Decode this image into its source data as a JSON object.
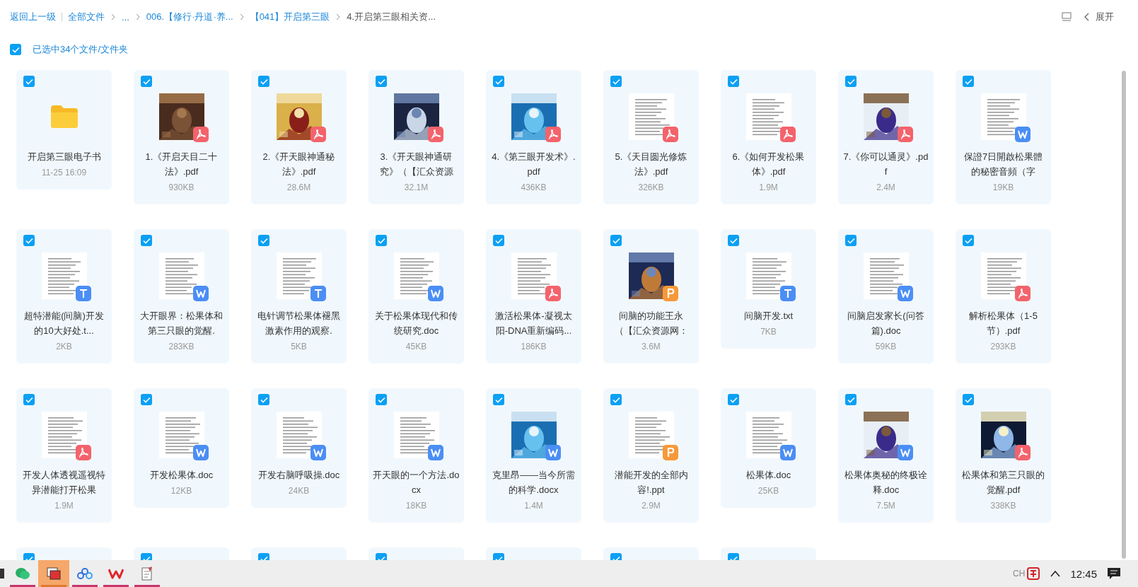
{
  "breadcrumb": {
    "back": "返回上一级",
    "items": [
      "全部文件",
      "...",
      "006.【修行·丹道·养...",
      "【041】开启第三眼"
    ],
    "current": "4.开启第三眼相关资..."
  },
  "expand_button": "展开",
  "selection": {
    "selected": true,
    "label": "已选中34个文件/文件夹"
  },
  "files": [
    {
      "kind": "folder",
      "name": "开启第三眼电子书",
      "meta": "11-25 16:09",
      "selected": true
    },
    {
      "kind": "pdf",
      "cover": true,
      "name": "1.《开启天目二十法》.pdf",
      "meta": "930KB",
      "selected": true
    },
    {
      "kind": "pdf",
      "cover": true,
      "name": "2.《开天眼神通秘法》.pdf",
      "meta": "28.6M",
      "selected": true
    },
    {
      "kind": "pdf",
      "cover": true,
      "name": "3.《开天眼神通研究》（【汇众资源",
      "meta": "32.1M",
      "selected": true
    },
    {
      "kind": "pdf",
      "cover": true,
      "name": "4.《第三眼开发术》.pdf",
      "meta": "436KB",
      "selected": true
    },
    {
      "kind": "pdf",
      "cover": false,
      "name": "5.《天目圆光修炼法》.pdf",
      "meta": "326KB",
      "selected": true
    },
    {
      "kind": "pdf",
      "cover": false,
      "name": "6.《如何开发松果体》.pdf",
      "meta": "1.9M",
      "selected": true
    },
    {
      "kind": "pdf",
      "cover": true,
      "name": "7.《你可以通灵》.pdf",
      "meta": "2.4M",
      "selected": true
    },
    {
      "kind": "doc",
      "cover": false,
      "name": "保證7日開啟松果體的秘密音頻（字",
      "meta": "19KB",
      "selected": true
    },
    {
      "kind": "txt",
      "cover": false,
      "name": "超特潜能(间脑)开发的10大好处.t...",
      "meta": "2KB",
      "selected": true
    },
    {
      "kind": "doc",
      "cover": false,
      "name": "大开眼界：松果体和第三只眼的觉醒.",
      "meta": "283KB",
      "selected": true
    },
    {
      "kind": "txt",
      "cover": false,
      "name": "电针调节松果体褪黑激素作用的观察.",
      "meta": "5KB",
      "selected": true
    },
    {
      "kind": "doc",
      "cover": false,
      "name": "关于松果体现代和传统研究.doc",
      "meta": "45KB",
      "selected": true
    },
    {
      "kind": "pdf",
      "cover": false,
      "name": "激活松果体-凝视太阳-DNA重新编码...",
      "meta": "186KB",
      "selected": true
    },
    {
      "kind": "ppt",
      "cover": true,
      "name": "间脑的功能王永（【汇众资源网：",
      "meta": "3.6M",
      "selected": true
    },
    {
      "kind": "txt",
      "cover": false,
      "name": "间脑开发.txt",
      "meta": "7KB",
      "selected": true
    },
    {
      "kind": "doc",
      "cover": false,
      "name": "间脑启发家长(问答篇).doc",
      "meta": "59KB",
      "selected": true
    },
    {
      "kind": "pdf",
      "cover": false,
      "name": "解析松果体（1-5节）.pdf",
      "meta": "293KB",
      "selected": true
    },
    {
      "kind": "pdf",
      "cover": false,
      "name": "开发人体透视遥视特异潜能打开松果",
      "meta": "1.9M",
      "selected": true
    },
    {
      "kind": "doc",
      "cover": false,
      "name": "开发松果体.doc",
      "meta": "12KB",
      "selected": true
    },
    {
      "kind": "doc",
      "cover": false,
      "name": "开发右脑呼吸操.doc",
      "meta": "24KB",
      "selected": true
    },
    {
      "kind": "doc",
      "cover": false,
      "name": "开天眼的一个方法.docx",
      "meta": "18KB",
      "selected": true
    },
    {
      "kind": "doc",
      "cover": true,
      "name": "克里昂——当今所需的科学.docx",
      "meta": "1.4M",
      "selected": true
    },
    {
      "kind": "ppt",
      "cover": false,
      "name": "潜能开发的全部内容!.ppt",
      "meta": "2.9M",
      "selected": true
    },
    {
      "kind": "doc",
      "cover": false,
      "name": "松果体.doc",
      "meta": "25KB",
      "selected": true
    },
    {
      "kind": "doc",
      "cover": true,
      "name": "松果体奥秘的终极诠释.doc",
      "meta": "7.5M",
      "selected": true
    },
    {
      "kind": "pdf",
      "cover": true,
      "name": "松果体和第三只眼的觉醒.pdf",
      "meta": "338KB",
      "selected": true
    },
    {
      "kind": "hidden",
      "selected": true
    },
    {
      "kind": "hidden",
      "selected": true
    },
    {
      "kind": "hidden",
      "selected": true
    },
    {
      "kind": "hidden",
      "selected": true
    },
    {
      "kind": "hidden",
      "selected": true
    },
    {
      "kind": "hidden",
      "selected": true
    },
    {
      "kind": "hidden",
      "selected": true
    }
  ],
  "taskbar": {
    "apps": [
      {
        "kind": "app",
        "selected": false
      },
      {
        "kind": "chat",
        "selected": false
      },
      {
        "kind": "window",
        "selected": true
      },
      {
        "kind": "cloud",
        "selected": false
      },
      {
        "kind": "office",
        "selected": false
      },
      {
        "kind": "notes",
        "selected": false
      }
    ],
    "ime": "CH",
    "time": "12:45"
  }
}
